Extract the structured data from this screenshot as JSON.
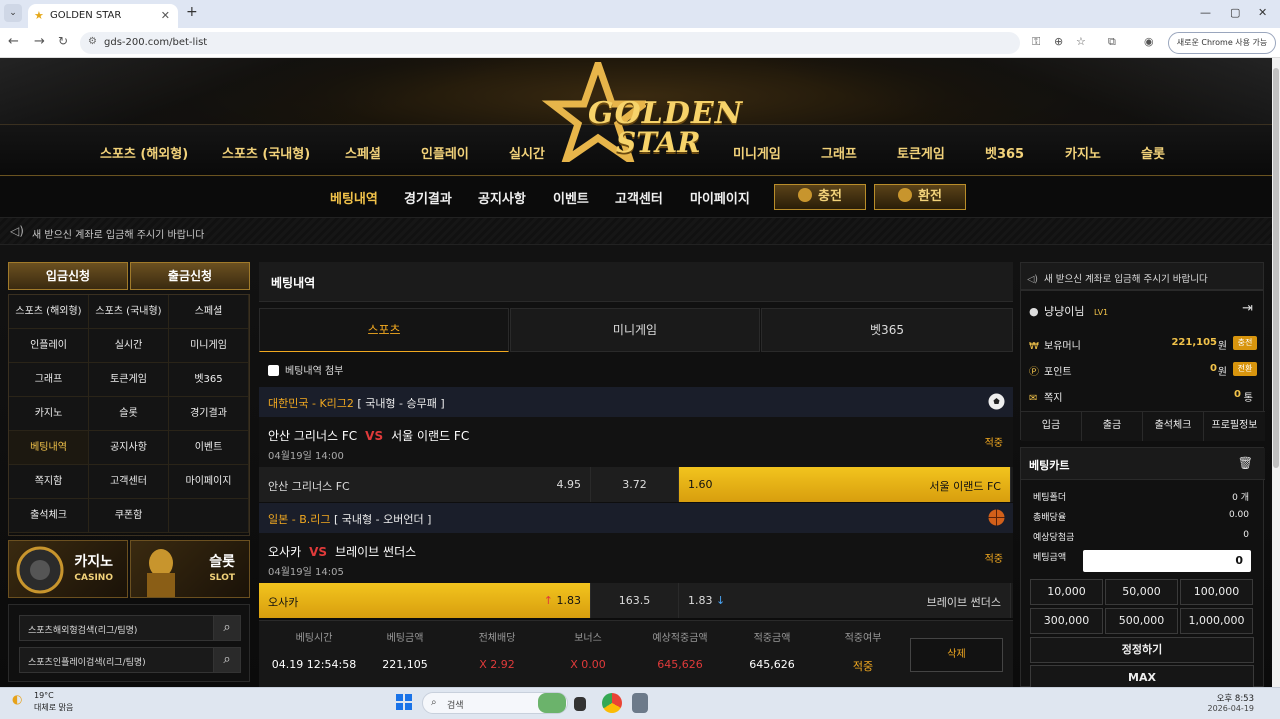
{
  "browser": {
    "tab_title": "GOLDEN STAR",
    "url": "gds-200.com/bet-list",
    "chrome_button": "새로운 Chrome 사용 가능"
  },
  "logo": {
    "line1": "GOLDEN",
    "line2": "STAR"
  },
  "main_nav": [
    "스포츠 (해외형)",
    "스포츠 (국내형)",
    "스페셜",
    "인플레이",
    "실시간",
    "미니게임",
    "그래프",
    "토큰게임",
    "벳365",
    "카지노",
    "슬롯"
  ],
  "sub_nav": [
    "베팅내역",
    "경기결과",
    "공지사항",
    "이벤트",
    "고객센터",
    "마이페이지"
  ],
  "sub_nav_buttons": {
    "charge": "충전",
    "exchange": "환전"
  },
  "notice": "새 받으신 계좌로 입금해 주시기 바랍니다",
  "left": {
    "deposit": "입금신청",
    "withdraw": "출금신청",
    "grid": [
      "스포츠 (해외형)",
      "스포츠 (국내형)",
      "스페셜",
      "인플레이",
      "실시간",
      "미니게임",
      "그래프",
      "토큰게임",
      "벳365",
      "카지노",
      "슬롯",
      "경기결과",
      "베팅내역",
      "공지사항",
      "이벤트",
      "쪽지함",
      "고객센터",
      "마이페이지",
      "출석체크",
      "쿠폰함",
      ""
    ],
    "promo_casino": {
      "ko": "카지노",
      "en": "CASINO"
    },
    "promo_slot": {
      "ko": "슬롯",
      "en": "SLOT"
    },
    "search1": "스포츠해외형검색(리그/팀명)",
    "search2": "스포츠인플레이검색(리그/팀명)"
  },
  "center": {
    "title": "베팅내역",
    "tabs": [
      "스포츠",
      "미니게임",
      "벳365"
    ],
    "attach_label": "베팅내역 첨부",
    "bets": [
      {
        "league_country": "대한민국 - K리그2",
        "league_type": "[ 국내형 - 승무패 ]",
        "home": "안산 그리너스 FC",
        "vs": "VS",
        "away": "서울 이랜드 FC",
        "date": "04월19일 14:00",
        "result": "적중",
        "odds_home_name": "안산 그리너스 FC",
        "odds_home": "4.95",
        "odds_draw": "3.72",
        "odds_away": "1.60",
        "odds_away_name": "서울 이랜드 FC",
        "selected": "away"
      },
      {
        "league_country": "일본 - B.리그",
        "league_type": "[ 국내형 - 오버언더 ]",
        "home": "오사카",
        "vs": "VS",
        "away": "브레이브 썬더스",
        "date": "04월19일 14:05",
        "result": "적중",
        "odds_home_name": "오사카",
        "odds_home": "1.83",
        "odds_draw": "163.5",
        "odds_away": "1.83",
        "odds_away_name": "브레이브 썬더스",
        "selected": "home"
      }
    ],
    "summary": {
      "headers": [
        "베팅시간",
        "베팅금액",
        "전체배당",
        "보너스",
        "예상적중금액",
        "적중금액",
        "적중여부"
      ],
      "values": [
        "04.19 12:54:58",
        "221,105",
        "X 2.92",
        "X 0.00",
        "645,626",
        "645,626",
        "적중"
      ],
      "delete": "삭제"
    }
  },
  "right": {
    "notice": "새 받으신 계좌로 입금해 주시기 바랍니다",
    "username": "냥냥이님",
    "level": "LV1",
    "money_label": "보유머니",
    "money_value": "221,105",
    "money_unit": "원",
    "money_btn": "충전",
    "point_label": "포인트",
    "point_value": "0",
    "point_unit": "원",
    "point_btn": "전환",
    "msg_label": "쪽지",
    "msg_value": "0",
    "msg_unit": "통",
    "buttons": [
      "입금",
      "출금",
      "출석체크",
      "프로필정보"
    ],
    "cart": {
      "title": "베팅카트",
      "folder_label": "베팅폴더",
      "folder_value": "0 개",
      "odds_label": "총배당율",
      "odds_value": "0.00",
      "expected_label": "예상당첨금",
      "expected_value": "0",
      "amount_label": "베팅금액",
      "amount_value": "0",
      "chips": [
        "10,000",
        "50,000",
        "100,000",
        "300,000",
        "500,000",
        "1,000,000"
      ],
      "reset": "정정하기",
      "max": "MAX"
    }
  },
  "taskbar": {
    "temp": "19°C",
    "weather": "대체로 맑음",
    "search": "검색",
    "time": "오후 8:53",
    "date": "2026-04-19"
  },
  "colors": {
    "gold": "#f2c34a",
    "accent": "#f2a920",
    "red": "#e03a3a"
  }
}
